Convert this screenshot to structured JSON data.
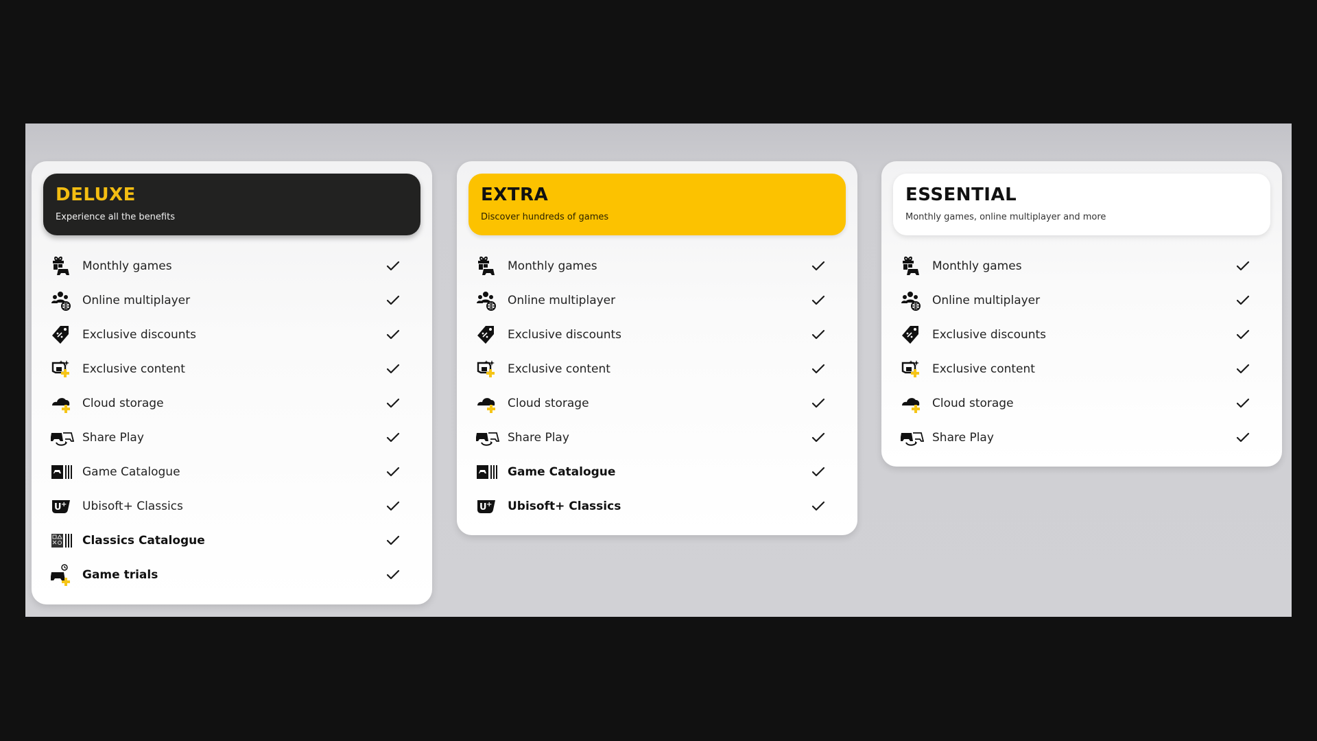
{
  "plans": [
    {
      "id": "deluxe",
      "title": "DELUXE",
      "subtitle": "Experience all the benefits",
      "features": [
        {
          "label": "Monthly games",
          "icon": "gift-controller-icon",
          "bold": false,
          "included": true
        },
        {
          "label": "Online multiplayer",
          "icon": "multiplayer-globe-icon",
          "bold": false,
          "included": true
        },
        {
          "label": "Exclusive discounts",
          "icon": "discount-tag-icon",
          "bold": false,
          "included": true
        },
        {
          "label": "Exclusive content",
          "icon": "exclusive-content-icon",
          "bold": false,
          "included": true
        },
        {
          "label": "Cloud storage",
          "icon": "cloud-storage-icon",
          "bold": false,
          "included": true
        },
        {
          "label": "Share Play",
          "icon": "share-play-icon",
          "bold": false,
          "included": true
        },
        {
          "label": "Game Catalogue",
          "icon": "game-catalogue-icon",
          "bold": false,
          "included": true
        },
        {
          "label": "Ubisoft+ Classics",
          "icon": "ubisoft-plus-icon",
          "bold": false,
          "included": true
        },
        {
          "label": "Classics Catalogue",
          "icon": "classics-catalogue-icon",
          "bold": true,
          "included": true
        },
        {
          "label": "Game trials",
          "icon": "game-trials-icon",
          "bold": true,
          "included": true
        }
      ]
    },
    {
      "id": "extra",
      "title": "EXTRA",
      "subtitle": "Discover hundreds of games",
      "features": [
        {
          "label": "Monthly games",
          "icon": "gift-controller-icon",
          "bold": false,
          "included": true
        },
        {
          "label": "Online multiplayer",
          "icon": "multiplayer-globe-icon",
          "bold": false,
          "included": true
        },
        {
          "label": "Exclusive discounts",
          "icon": "discount-tag-icon",
          "bold": false,
          "included": true
        },
        {
          "label": "Exclusive content",
          "icon": "exclusive-content-icon",
          "bold": false,
          "included": true
        },
        {
          "label": "Cloud storage",
          "icon": "cloud-storage-icon",
          "bold": false,
          "included": true
        },
        {
          "label": "Share Play",
          "icon": "share-play-icon",
          "bold": false,
          "included": true
        },
        {
          "label": "Game Catalogue",
          "icon": "game-catalogue-icon",
          "bold": true,
          "included": true
        },
        {
          "label": "Ubisoft+ Classics",
          "icon": "ubisoft-plus-icon",
          "bold": true,
          "included": true
        }
      ]
    },
    {
      "id": "essential",
      "title": "ESSENTIAL",
      "subtitle": "Monthly games, online multiplayer and more",
      "features": [
        {
          "label": "Monthly games",
          "icon": "gift-controller-icon",
          "bold": false,
          "included": true
        },
        {
          "label": "Online multiplayer",
          "icon": "multiplayer-globe-icon",
          "bold": false,
          "included": true
        },
        {
          "label": "Exclusive discounts",
          "icon": "discount-tag-icon",
          "bold": false,
          "included": true
        },
        {
          "label": "Exclusive content",
          "icon": "exclusive-content-icon",
          "bold": false,
          "included": true
        },
        {
          "label": "Cloud storage",
          "icon": "cloud-storage-icon",
          "bold": false,
          "included": true
        },
        {
          "label": "Share Play",
          "icon": "share-play-icon",
          "bold": false,
          "included": true
        }
      ]
    }
  ],
  "colors": {
    "deluxe_header": "#222221",
    "deluxe_title": "#f3bd12",
    "extra_header": "#fcc200",
    "essential_header": "#ffffff",
    "ps_plus_gold": "#f5c518"
  }
}
